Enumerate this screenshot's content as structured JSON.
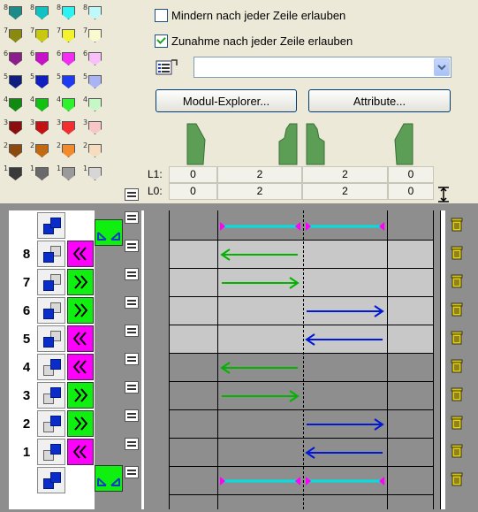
{
  "swatches": [
    {
      "n1": "8",
      "c1": "#1e8a8a",
      "n2": "8",
      "c2": "#12c2c2",
      "n3": "8",
      "c3": "#2ef2f2",
      "n4": "8",
      "c4": "#bff8f8"
    },
    {
      "n1": "7",
      "c1": "#8a8a10",
      "n2": "7",
      "c2": "#c8c810",
      "n3": "7",
      "c3": "#f2f22e",
      "n4": "7",
      "c4": "#fafad0"
    },
    {
      "n1": "6",
      "c1": "#8a1e8a",
      "n2": "6",
      "c2": "#c812c8",
      "n3": "6",
      "c3": "#f22ef2",
      "n4": "6",
      "c4": "#f8bff8"
    },
    {
      "n1": "5",
      "c1": "#101e80",
      "n2": "5",
      "c2": "#1020c0",
      "n3": "5",
      "c3": "#1e3af2",
      "n4": "5",
      "c4": "#aab4f2"
    },
    {
      "n1": "4",
      "c1": "#108a10",
      "n2": "4",
      "c2": "#12c212",
      "n3": "4",
      "c3": "#2ef22e",
      "n4": "4",
      "c4": "#c6f8c6"
    },
    {
      "n1": "3",
      "c1": "#8a1010",
      "n2": "3",
      "c2": "#c21212",
      "n3": "3",
      "c3": "#f22e2e",
      "n4": "3",
      "c4": "#f8c6c6"
    },
    {
      "n1": "2",
      "c1": "#8a4a10",
      "n2": "2",
      "c2": "#c26a12",
      "n3": "2",
      "c3": "#f28a2e",
      "n4": "2",
      "c4": "#f8dcc0"
    },
    {
      "n1": "1",
      "c1": "#3a3a3a",
      "n2": "1",
      "c2": "#6a6a6a",
      "n3": "1",
      "c3": "#9a9a9a",
      "n4": "1",
      "c4": "#d6d6d6"
    }
  ],
  "options": {
    "decrease_label": "Mindern nach jeder Zeile erlauben",
    "decrease_checked": false,
    "increase_label": "Zunahme nach jeder Zeile erlauben",
    "increase_checked": true
  },
  "combo": {
    "value": ""
  },
  "buttons": {
    "module_explorer": "Modul-Explorer...",
    "attributes": "Attribute..."
  },
  "table": {
    "l1_label": "L1:",
    "l0_label": "L0:",
    "l1_values": [
      "0",
      "2",
      "2",
      "0"
    ],
    "l0_values": [
      "0",
      "2",
      "2",
      "0"
    ]
  },
  "rows": [
    {
      "label": "",
      "kind": "top"
    },
    {
      "label": "8",
      "kind": "row",
      "dir": "left",
      "color": "green"
    },
    {
      "label": "7",
      "kind": "row",
      "dir": "right",
      "color": "green"
    },
    {
      "label": "6",
      "kind": "row",
      "dir": "right",
      "color": "blue"
    },
    {
      "label": "5",
      "kind": "row",
      "dir": "left",
      "color": "blue"
    },
    {
      "label": "4",
      "kind": "row",
      "dir": "left",
      "color": "green"
    },
    {
      "label": "3",
      "kind": "row",
      "dir": "right",
      "color": "green"
    },
    {
      "label": "2",
      "kind": "row",
      "dir": "right",
      "color": "blue"
    },
    {
      "label": "1",
      "kind": "row",
      "dir": "left",
      "color": "blue"
    },
    {
      "label": "",
      "kind": "bottom"
    }
  ],
  "colors": {
    "magenta": "#ff00ff",
    "green": "#10f010",
    "arrow_green": "#00b400",
    "arrow_blue": "#0018d8",
    "cyan": "#00e0e0"
  }
}
